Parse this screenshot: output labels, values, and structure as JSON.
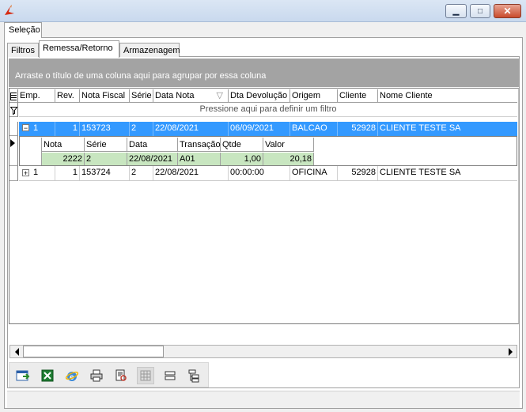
{
  "window": {
    "icons": {
      "logo": "app-logo-icon",
      "minimize": "minimize-icon",
      "maximize": "maximize-icon",
      "close": "close-icon"
    },
    "minimize_glyph": "▁",
    "maximize_glyph": "□",
    "close_glyph": "✕"
  },
  "outer_tab": {
    "label": "Seleção"
  },
  "tabs": [
    {
      "label": "Filtros"
    },
    {
      "label": "Remessa/Retorno"
    },
    {
      "label": "Armazenagem"
    }
  ],
  "grid": {
    "group_panel_text": "Arraste o título de uma coluna aqui para agrupar por essa coluna",
    "filter_text": "Pressione aqui para definir um filtro",
    "columns": [
      "Emp.",
      "Rev.",
      "Nota Fiscal",
      "Série",
      "Data Nota",
      "Dta Devolução",
      "Origem",
      "Cliente",
      "Nome Cliente"
    ],
    "sort_glyph": "▽",
    "rows": [
      {
        "expander": "−",
        "emp": "1",
        "rev": "1",
        "nota_fiscal": "153723",
        "serie": "2",
        "data_nota": "22/08/2021",
        "dta_devolucao": "06/09/2021",
        "origem": "BALCAO",
        "cliente": "52928",
        "nome_cliente": "CLIENTE TESTE SA"
      },
      {
        "expander": "+",
        "emp": "1",
        "rev": "1",
        "nota_fiscal": "153724",
        "serie": "2",
        "data_nota": "22/08/2021",
        "dta_devolucao": "00:00:00",
        "origem": "OFICINA",
        "cliente": "52928",
        "nome_cliente": "CLIENTE TESTE SA"
      }
    ],
    "detail": {
      "columns": [
        "Nota",
        "Série",
        "Data",
        "Transação",
        "Qtde",
        "Valor"
      ],
      "row": {
        "nota": "2222",
        "serie": "2",
        "data": "22/08/2021",
        "transacao": "A01",
        "qtde": "1,00",
        "valor": "20,18"
      }
    }
  },
  "toolbar": {
    "buttons": [
      {
        "name": "export-button",
        "icon": "export-icon"
      },
      {
        "name": "excel-button",
        "icon": "excel-icon"
      },
      {
        "name": "browser-button",
        "icon": "browser-icon"
      },
      {
        "name": "print-button",
        "icon": "printer-icon"
      },
      {
        "name": "print-preview-button",
        "icon": "print-preview-icon"
      },
      {
        "name": "configure-button",
        "icon": "configure-icon"
      },
      {
        "name": "collapse-button",
        "icon": "collapse-icon"
      },
      {
        "name": "expand-button",
        "icon": "expand-icon"
      }
    ]
  }
}
